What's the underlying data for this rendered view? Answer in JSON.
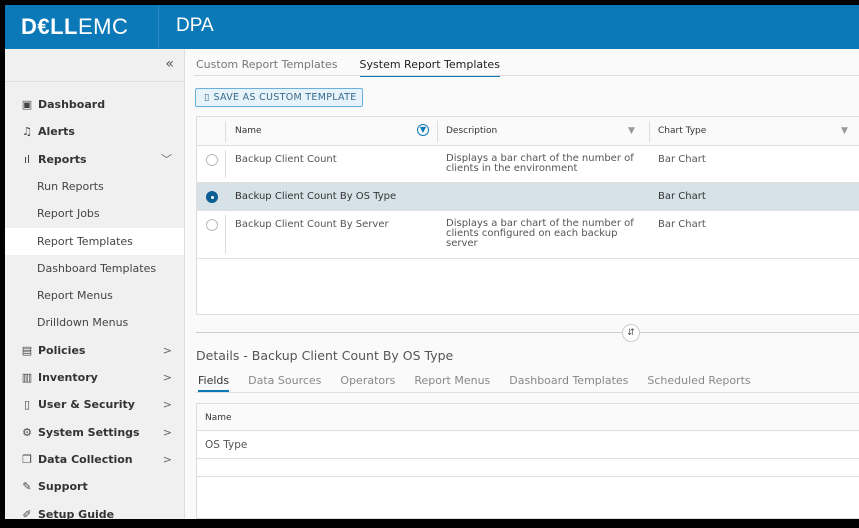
{
  "header": {
    "logo_text": "DELLEMC",
    "logo_dell": "D€LL",
    "logo_emc": "EMC",
    "product": "DPA"
  },
  "sidebar": {
    "collapse_icon": "«",
    "items": [
      {
        "label": "Dashboard",
        "icon": "▣"
      },
      {
        "label": "Alerts",
        "icon": "♫"
      },
      {
        "label": "Reports",
        "icon": "ıl",
        "chevron": "﹀"
      },
      {
        "label": "Run Reports"
      },
      {
        "label": "Report Jobs"
      },
      {
        "label": "Report Templates"
      },
      {
        "label": "Dashboard Templates"
      },
      {
        "label": "Report Menus"
      },
      {
        "label": "Drilldown Menus"
      },
      {
        "label": "Policies",
        "icon": "▤",
        "chevron": ">"
      },
      {
        "label": "Inventory",
        "icon": "▥",
        "chevron": ">"
      },
      {
        "label": "User & Security",
        "icon": "▯",
        "chevron": ">"
      },
      {
        "label": "System Settings",
        "icon": "⚙",
        "chevron": ">"
      },
      {
        "label": "Data Collection",
        "icon": "❐",
        "chevron": ">"
      },
      {
        "label": "Support",
        "icon": "✎"
      },
      {
        "label": "Setup Guide",
        "icon": "✐"
      }
    ]
  },
  "main": {
    "tabs": [
      "Custom Report Templates",
      "System Report Templates"
    ],
    "save_button": "SAVE AS CUSTOM TEMPLATE",
    "columns": [
      "Name",
      "Description",
      "Chart Type"
    ],
    "rows": [
      {
        "name": "Backup Client Count",
        "description": "Displays a bar chart of the number of clients in the environment",
        "chart_type": "Bar Chart"
      },
      {
        "name": "Backup Client Count By OS Type",
        "description": "",
        "chart_type": "Bar Chart"
      },
      {
        "name": "Backup Client Count By Server",
        "description": "Displays a bar chart of the number of clients configured on each backup server",
        "chart_type": "Bar Chart"
      }
    ],
    "splitter_icon": "⇵"
  },
  "details": {
    "title": "Details - Backup Client Count By OS Type",
    "tabs": [
      "Fields",
      "Data Sources",
      "Operators",
      "Report Menus",
      "Dashboard Templates",
      "Scheduled Reports"
    ],
    "column": "Name",
    "fields": [
      "OS Type"
    ]
  }
}
